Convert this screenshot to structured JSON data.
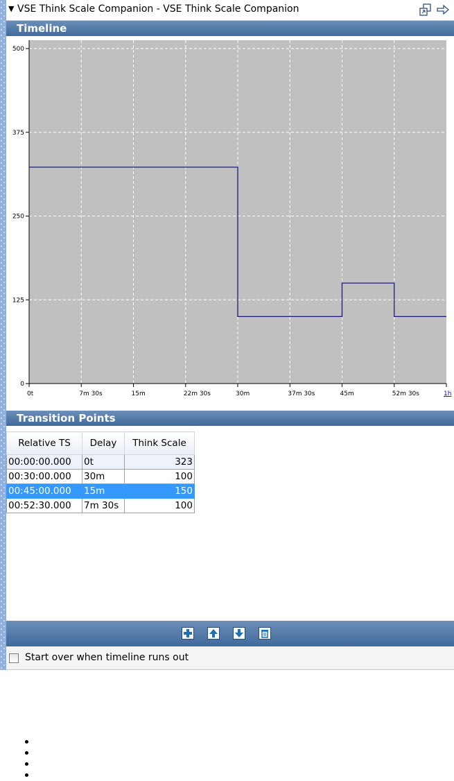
{
  "window": {
    "title": "VSE Think Scale Companion - VSE Think Scale Companion",
    "collapse_icon": "triangle-down-icon",
    "icons": [
      "float-window-icon",
      "dock-arrow-icon"
    ]
  },
  "timeline": {
    "header": "Timeline"
  },
  "chart_data": {
    "type": "line",
    "step": true,
    "x_ticks": [
      "0t",
      "7m 30s",
      "15m",
      "22m 30s",
      "30m",
      "37m 30s",
      "45m",
      "52m 30s",
      "1h"
    ],
    "x_ticks_minutes": [
      0,
      7.5,
      15,
      22.5,
      30,
      37.5,
      45,
      52.5,
      60
    ],
    "y_ticks": [
      "0",
      "125",
      "250",
      "375",
      "500"
    ],
    "ylim": [
      0,
      500
    ],
    "xlim_minutes": [
      0,
      60
    ],
    "series": [
      {
        "x_minutes": [
          0,
          30,
          45,
          52.5,
          60
        ],
        "y": [
          323,
          100,
          150,
          100,
          100
        ]
      }
    ],
    "grid": true,
    "background": "#c0c0c0",
    "line_color": "#1a1a7a"
  },
  "transition": {
    "header": "Transition Points",
    "columns": [
      "Relative TS",
      "Delay",
      "Think Scale"
    ],
    "rows": [
      {
        "ts": "00:00:00.000",
        "delay": "0t",
        "scale": "323"
      },
      {
        "ts": "00:30:00.000",
        "delay": "30m",
        "scale": "100"
      },
      {
        "ts": "00:45:00.000",
        "delay": "15m",
        "scale": "150"
      },
      {
        "ts": "00:52:30.000",
        "delay": "7m 30s",
        "scale": "100"
      }
    ],
    "selected_row": 2
  },
  "buttons": [
    "add-icon",
    "move-up-icon",
    "move-down-icon",
    "delete-icon"
  ],
  "options": {
    "start_over_label": "Start over when timeline runs out",
    "start_over_checked": false
  },
  "colors": {
    "header_top": "#6c8fb8",
    "header_bottom": "#3f6a9c",
    "selection": "#3399ff"
  }
}
